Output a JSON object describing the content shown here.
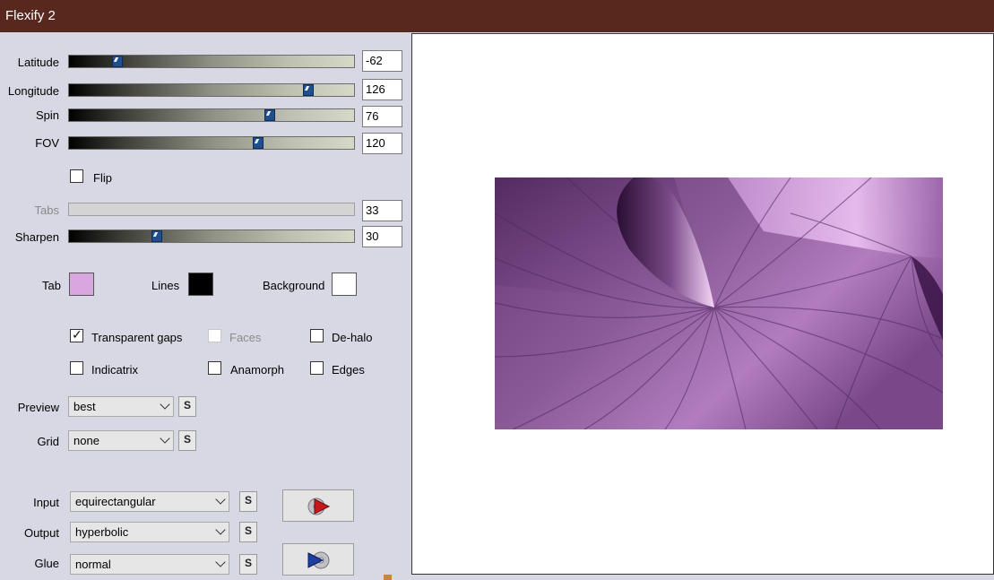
{
  "window": {
    "title": "Flexify 2"
  },
  "sliders": [
    {
      "label": "Latitude",
      "value": "-62",
      "position": 0.17,
      "disabled": false
    },
    {
      "label": "Longitude",
      "value": "126",
      "position": 0.835,
      "disabled": false
    },
    {
      "label": "Spin",
      "value": "76",
      "position": 0.7,
      "disabled": false
    },
    {
      "label": "FOV",
      "value": "120",
      "position": 0.665,
      "disabled": false
    },
    {
      "label": "Tabs",
      "value": "33",
      "position": null,
      "disabled": true
    },
    {
      "label": "Sharpen",
      "value": "30",
      "position": 0.305,
      "disabled": false
    }
  ],
  "flip": {
    "label": "Flip",
    "checked": false
  },
  "colors": {
    "tab": {
      "label": "Tab",
      "value": "#d9a6e0"
    },
    "lines": {
      "label": "Lines",
      "value": "#000000"
    },
    "background": {
      "label": "Background",
      "value": "#ffffff"
    }
  },
  "options": {
    "transparent_gaps": {
      "label": "Transparent gaps",
      "checked": true
    },
    "faces": {
      "label": "Faces",
      "checked": false,
      "disabled": true
    },
    "de_halo": {
      "label": "De-halo",
      "checked": false
    },
    "indicatrix": {
      "label": "Indicatrix",
      "checked": false
    },
    "anamorph": {
      "label": "Anamorph",
      "checked": false
    },
    "edges": {
      "label": "Edges",
      "checked": false
    }
  },
  "dropdowns": {
    "preview": {
      "label": "Preview",
      "value": "best"
    },
    "grid": {
      "label": "Grid",
      "value": "none"
    },
    "input": {
      "label": "Input",
      "value": "equirectangular"
    },
    "output": {
      "label": "Output",
      "value": "hyperbolic"
    },
    "glue": {
      "label": "Glue",
      "value": "normal"
    }
  },
  "icons": {
    "small_button": "S",
    "action_top": "play-red-icon",
    "action_bottom": "play-blue-icon"
  }
}
